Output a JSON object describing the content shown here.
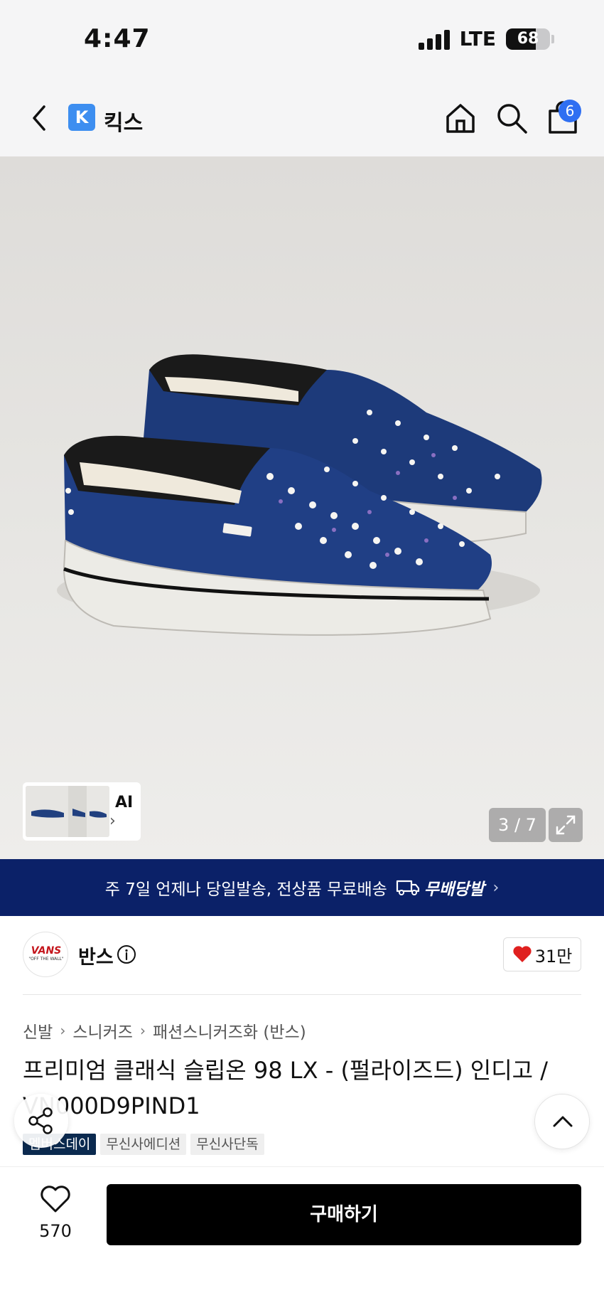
{
  "status_bar": {
    "time": "4:47",
    "network": "LTE",
    "battery": "68",
    "battery_level": 0.68
  },
  "nav": {
    "store_logo_letter": "K",
    "store_name": "킥스",
    "cart_count": "6",
    "icons": [
      "back-arrow-icon",
      "home-icon",
      "search-icon",
      "cart-icon"
    ]
  },
  "gallery": {
    "ai_label": "AI",
    "page_indicator": "3 / 7"
  },
  "shipping_banner": {
    "text": "주 7일 언제나 당일발송, 전상품 무료배송",
    "badge": "무배당발"
  },
  "brand": {
    "name": "반스",
    "logo_text": "VANS",
    "logo_sub": "\"OFF THE WALL\"",
    "likes": "31만"
  },
  "breadcrumb": [
    "신발",
    "스니커즈",
    "패션스니커즈화 (반스)"
  ],
  "product": {
    "title": "프리미엄 클래식 슬립온 98 LX - (펄라이즈드) 인디고 / VN000D9PIND1",
    "tags": [
      "멤버스데이",
      "무신사에디션",
      "무신사단독"
    ]
  },
  "bottom_bar": {
    "wish_count": "570",
    "buy_label": "구매하기"
  },
  "colors": {
    "banner_bg": "#0b2168",
    "cart_badge": "#2f6ff2",
    "store_logo": "#3d8ef0",
    "heart": "#e0201f",
    "buy_button": "#000000",
    "tag_primary": "#0b2a4f"
  }
}
